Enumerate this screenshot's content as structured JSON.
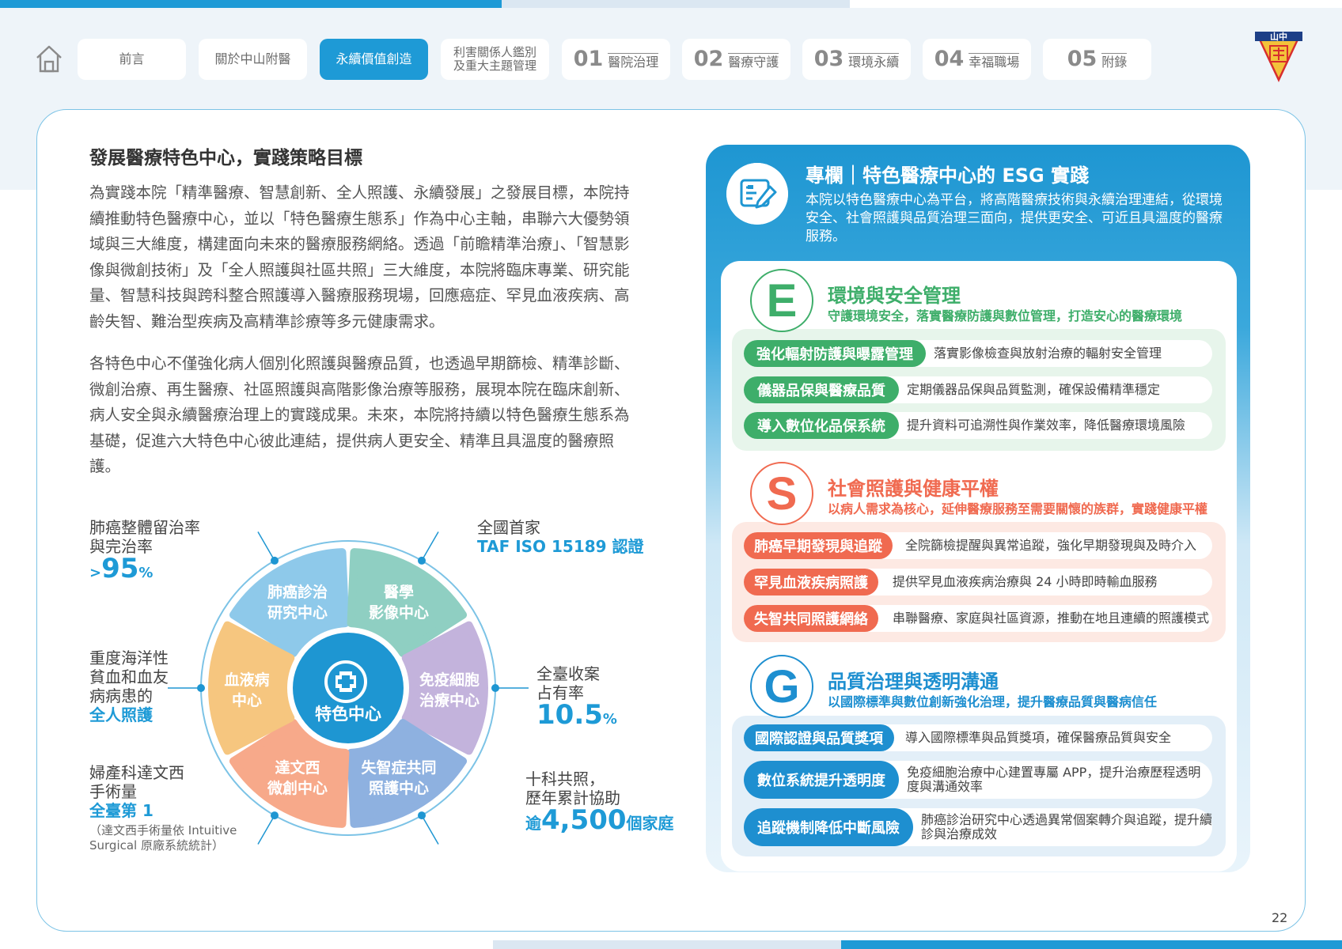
{
  "nav": {
    "tabs": [
      {
        "label": "前言"
      },
      {
        "label": "關於中山附醫"
      },
      {
        "label": "永續價值創造"
      },
      {
        "label": "利害關係人鑑別\n及重大主題管理"
      },
      {
        "num": "01",
        "label": "醫院治理"
      },
      {
        "num": "02",
        "label": "醫療守護"
      },
      {
        "num": "03",
        "label": "環境永續"
      },
      {
        "num": "04",
        "label": "幸福職場"
      },
      {
        "num": "05",
        "label": "附錄"
      }
    ],
    "logo_text": "山中"
  },
  "main": {
    "title": "發展醫療特色中心，實踐策略目標",
    "para1": "為實踐本院「精準醫療、智慧創新、全人照護、永續發展」之發展目標，本院持續推動特色醫療中心，並以「特色醫療生態系」作為中心主軸，串聯六大優勢領域與三大維度，構建面向未來的醫療服務網絡。透過「前瞻精準治療」、「智慧影像與微創技術」及「全人照護與社區共照」三大維度，本院將臨床專業、研究能量、智慧科技與跨科整合照護導入醫療服務現場，回應癌症、罕見血液疾病、高齡失智、難治型疾病及高精準診療等多元健康需求。",
    "para2": "各特色中心不僅強化病人個別化照護與醫療品質，也透過早期篩檢、精準診斷、微創治療、再生醫療、社區照護與高階影像治療等服務，展現本院在臨床創新、病人安全與永續醫療治理上的實踐成果。未來，本院將持續以特色醫療生態系為基礎，促進六大特色中心彼此連結，提供病人更安全、精準且具溫度的醫療照護。"
  },
  "wheel": {
    "center": "特色中心",
    "segments": [
      {
        "label1": "肺癌診治",
        "label2": "研究中心",
        "color": "#8ec9ea"
      },
      {
        "label1": "醫學",
        "label2": "影像中心",
        "color": "#8fcfc2"
      },
      {
        "label1": "免疫細胞",
        "label2": "治療中心",
        "color": "#c3b3dc"
      },
      {
        "label1": "失智症共同",
        "label2": "照護中心",
        "color": "#8eb1e0"
      },
      {
        "label1": "達文西",
        "label2": "微創中心",
        "color": "#f7a98a"
      },
      {
        "label1": "血液病",
        "label2": "中心",
        "color": "#f6c67f"
      }
    ],
    "callouts": {
      "lung": {
        "line1": "肺癌整體留治率",
        "line2": "與完治率",
        "prefix": ">",
        "value": "95",
        "unit": "%"
      },
      "imaging": {
        "line1": "全國首家",
        "line2": "TAF ISO 15189 認證"
      },
      "blood": {
        "line1": "重度海洋性",
        "line2": "貧血和血友",
        "line3": "病病患的",
        "line4": "全人照護"
      },
      "immune": {
        "line1": "全臺收案",
        "line2": "占有率",
        "value": "10.5",
        "unit": "%"
      },
      "davinci": {
        "line1": "婦產科達文西",
        "line2": "手術量",
        "line3": "全臺第 1",
        "note1": "（達文西手術量依 Intuitive",
        "note2": "Surgical 原廠系統統計）"
      },
      "dementia": {
        "line1": "十科共照，",
        "line2": "歷年累計協助",
        "prefix": "逾",
        "value": "4,500",
        "unit": "個家庭"
      }
    }
  },
  "special": {
    "title": "專欄｜特色醫療中心的 ESG 實踐",
    "desc": "本院以特色醫療中心為平台，將高階醫療技術與永續治理連結，從環境安全、社會照護與品質治理三面向，提供更安全、可近且具溫度的醫療服務。",
    "sections": [
      {
        "letter": "E",
        "title": "環境與安全管理",
        "subtitle": "守護環境安全，落實醫療防護與數位管理，打造安心的醫療環境",
        "color": "#3eae6a",
        "bg": "#e7f5eb",
        "items": [
          {
            "label": "強化輻射防護與曝露管理",
            "desc": "落實影像檢查與放射治療的輻射安全管理"
          },
          {
            "label": "儀器品保與醫療品質",
            "desc": "定期儀器品保與品質監測，確保設備精準穩定"
          },
          {
            "label": "導入數位化品保系統",
            "desc": "提升資料可追溯性與作業效率，降低醫療環境風險"
          }
        ]
      },
      {
        "letter": "S",
        "title": "社會照護與健康平權",
        "subtitle": "以病人需求為核心，延伸醫療服務至需要關懷的族群，實踐健康平權",
        "color": "#f06a50",
        "bg": "#fde9e3",
        "items": [
          {
            "label": "肺癌早期發現與追蹤",
            "desc": "全院篩檢提醒與異常追蹤，強化早期發現與及時介入"
          },
          {
            "label": "罕見血液疾病照護",
            "desc": "提供罕見血液疾病治療與 24 小時即時輸血服務"
          },
          {
            "label": "失智共同照護網絡",
            "desc": "串聯醫療、家庭與社區資源，推動在地且連續的照護模式"
          }
        ]
      },
      {
        "letter": "G",
        "title": "品質治理與透明溝通",
        "subtitle": "以國際標準與數位創新強化治理，提升醫療品質與醫病信任",
        "color": "#1e8fd0",
        "bg": "#e3eff8",
        "items": [
          {
            "label": "國際認證與品質獎項",
            "desc": "導入國際標準與品質獎項，確保醫療品質與安全"
          },
          {
            "label": "數位系統提升透明度",
            "desc": "免疫細胞治療中心建置專屬 APP，提升治療歷程透明度與溝通效率"
          },
          {
            "label": "追蹤機制降低中斷風險",
            "desc": "肺癌診治研究中心透過異常個案轉介與追蹤，提升續診與治療成效"
          }
        ]
      }
    ]
  },
  "page_number": "22"
}
